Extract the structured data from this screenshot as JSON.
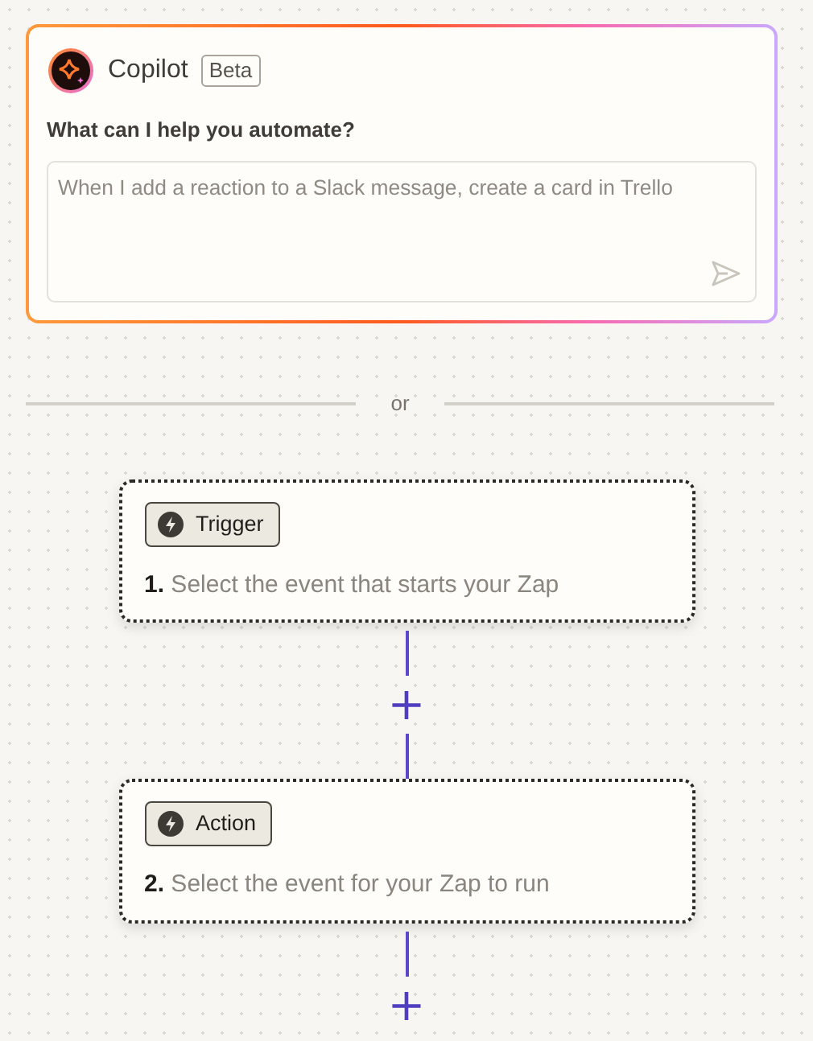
{
  "copilot": {
    "title": "Copilot",
    "badge": "Beta",
    "prompt": "What can I help you automate?",
    "placeholder": "When I add a reaction to a Slack message, create a card in Trello"
  },
  "divider": {
    "label": "or"
  },
  "steps": [
    {
      "tag": "Trigger",
      "number": "1.",
      "text": "Select the event that starts your Zap"
    },
    {
      "tag": "Action",
      "number": "2.",
      "text": "Select the event for your Zap to run"
    }
  ],
  "add_symbols": [
    "+",
    "+"
  ]
}
